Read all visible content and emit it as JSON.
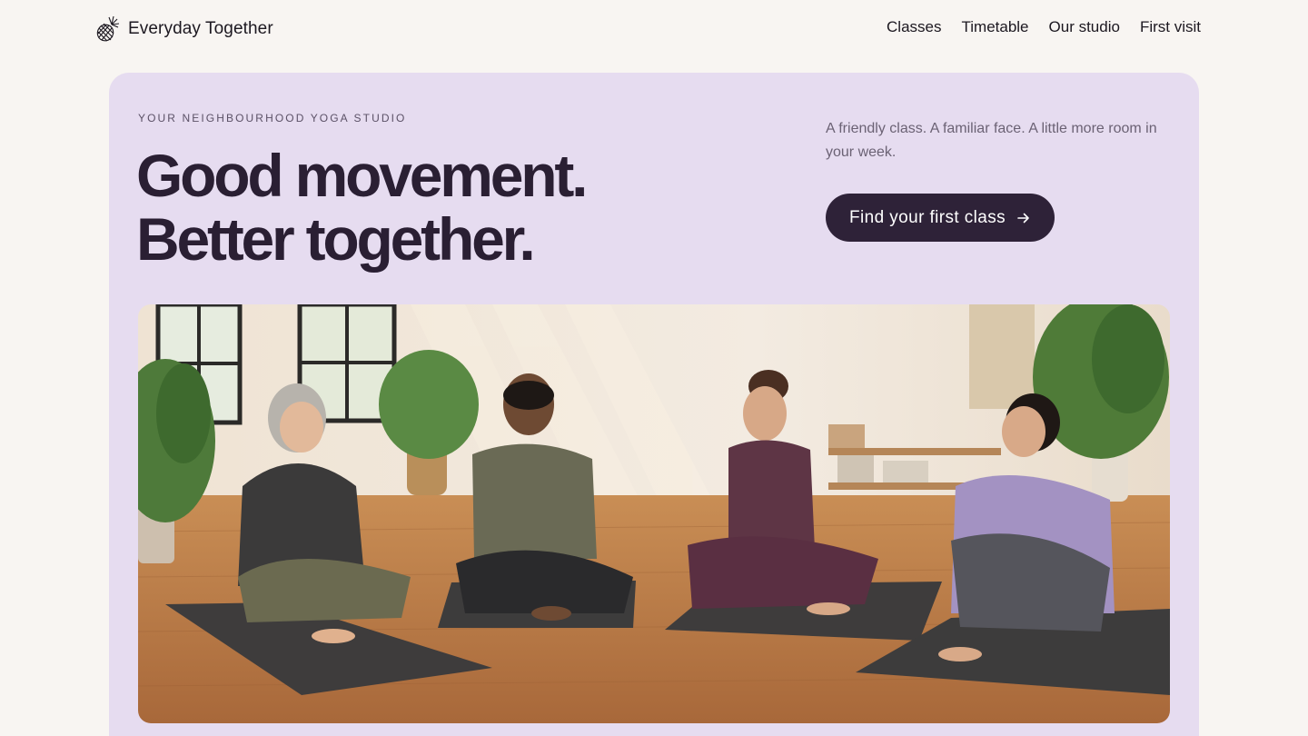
{
  "brand": {
    "name": "Everyday Together",
    "icon": "pineapple-icon"
  },
  "nav": {
    "items": [
      {
        "label": "Classes"
      },
      {
        "label": "Timetable"
      },
      {
        "label": "Our studio"
      },
      {
        "label": "First visit"
      }
    ]
  },
  "hero": {
    "eyebrow": "YOUR NEIGHBOURHOOD YOGA STUDIO",
    "headline_line1": "Good movement.",
    "headline_line2": "Better together.",
    "tagline": "A friendly class. A familiar face. A little more room in your week.",
    "cta_label": "Find your first class",
    "cta_icon": "arrow-right-icon",
    "background_color": "#e6dcf0",
    "cta_color": "#2e2238"
  }
}
